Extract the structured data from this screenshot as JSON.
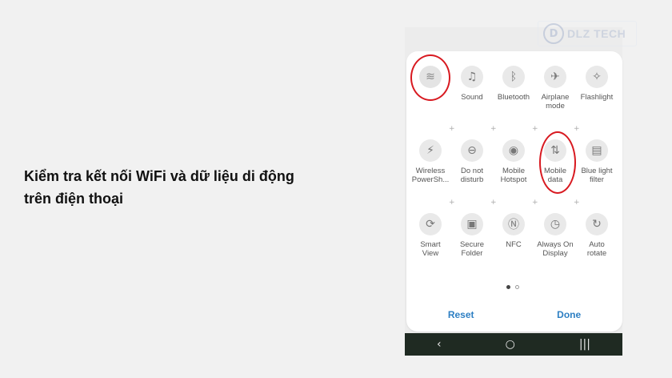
{
  "caption": {
    "line1": "Kiểm tra kết nối WiFi và dữ liệu di động",
    "line2": "trên điện thoại"
  },
  "watermark": {
    "mark": "D",
    "text": "DLZ TECH"
  },
  "quick_settings": {
    "tiles": [
      {
        "id": "wifi",
        "label": "",
        "glyph": "≋",
        "icon": "wifi-icon",
        "active": true
      },
      {
        "id": "sound",
        "label": "Sound",
        "glyph": "♫",
        "icon": "sound-icon"
      },
      {
        "id": "bluetooth",
        "label": "Bluetooth",
        "glyph": "ᛒ",
        "icon": "bluetooth-icon"
      },
      {
        "id": "airplane",
        "label": "Airplane\nmode",
        "glyph": "✈",
        "icon": "airplane-icon"
      },
      {
        "id": "flashlight",
        "label": "Flashlight",
        "glyph": "✧",
        "icon": "flashlight-icon"
      },
      {
        "id": "wireless-powershare",
        "label": "Wireless\nPowerSh...",
        "glyph": "⚡",
        "icon": "battery-share-icon"
      },
      {
        "id": "do-not-disturb",
        "label": "Do not\ndisturb",
        "glyph": "⊖",
        "icon": "do-not-disturb-icon"
      },
      {
        "id": "mobile-hotspot",
        "label": "Mobile\nHotspot",
        "glyph": "◉",
        "icon": "hotspot-icon"
      },
      {
        "id": "mobile-data",
        "label": "Mobile\ndata",
        "glyph": "⇅",
        "icon": "mobile-data-icon"
      },
      {
        "id": "blue-light-filter",
        "label": "Blue light\nfilter",
        "glyph": "▤",
        "icon": "blue-light-filter-icon"
      },
      {
        "id": "smart-view",
        "label": "Smart\nView",
        "glyph": "⟳",
        "icon": "smart-view-icon"
      },
      {
        "id": "secure-folder",
        "label": "Secure\nFolder",
        "glyph": "▣",
        "icon": "secure-folder-icon"
      },
      {
        "id": "nfc",
        "label": "NFC",
        "glyph": "Ⓝ",
        "icon": "nfc-icon"
      },
      {
        "id": "always-on-display",
        "label": "Always On\nDisplay",
        "glyph": "◷",
        "icon": "always-on-display-icon"
      },
      {
        "id": "auto-rotate",
        "label": "Auto\nrotate",
        "glyph": "↻",
        "icon": "auto-rotate-icon"
      }
    ],
    "plus_glyph": "+"
  },
  "page_indicator": {
    "pages": 2,
    "current": 1
  },
  "actions": {
    "reset": "Reset",
    "done": "Done"
  },
  "navbar": {
    "back": "‹",
    "home": "○",
    "recents": "|||"
  },
  "colors": {
    "highlight_ring": "#d81920",
    "action_text": "#2d7fc3",
    "navbar_bg": "#1f2a22"
  }
}
